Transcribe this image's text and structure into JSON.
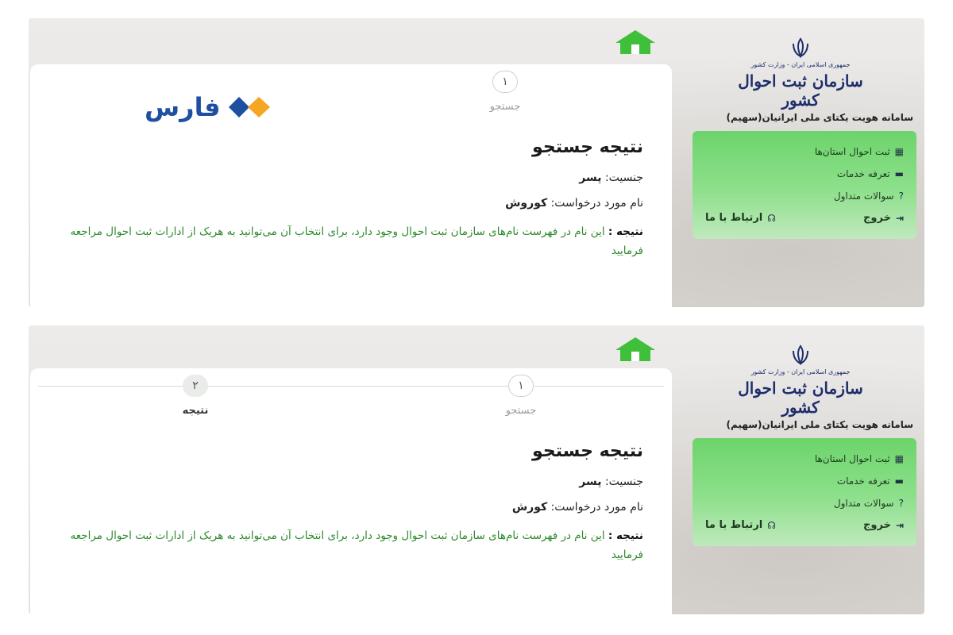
{
  "brand": {
    "watermark": "فارس"
  },
  "panels": [
    {
      "steps": [
        {
          "num": "۱",
          "label": "جستجو",
          "active": false
        }
      ],
      "result": {
        "title": "نتیجه جستجو",
        "gender_label": "جنسیت:",
        "gender_value": "پسر",
        "name_label": "نام مورد درخواست:",
        "name_value": "کوروش",
        "note_label": "نتیجه :",
        "note_text": "این نام در فهرست نام‌های سازمان ثبت احوال وجود دارد، برای انتخاب آن می‌توانید به هریک از ادارات ثبت احوال مراجعه فرمایید"
      }
    },
    {
      "steps": [
        {
          "num": "۱",
          "label": "جستجو",
          "active": false
        },
        {
          "num": "۲",
          "label": "نتیجه",
          "active": true
        }
      ],
      "result": {
        "title": "نتیجه جستجو",
        "gender_label": "جنسیت:",
        "gender_value": "پسر",
        "name_label": "نام مورد درخواست:",
        "name_value": "کورش",
        "note_label": "نتیجه :",
        "note_text": "این نام در فهرست نام‌های سازمان ثبت احوال وجود دارد، برای انتخاب آن می‌توانید به هریک از ادارات ثبت احوال مراجعه فرمایید"
      }
    }
  ],
  "sidebar": {
    "org_small": "جمهوری اسلامی ایران - وزارت کشور",
    "org_name": "سازمان ثبت احوال کشور",
    "system_title": "سامانه هویت یکتای ملی ایرانیان(سهیم)",
    "menu": [
      {
        "label": "ثبت احوال استان‌ها",
        "icon": "building-icon"
      },
      {
        "label": "تعرفه خدمات",
        "icon": "money-icon"
      },
      {
        "label": "سوالات متداول",
        "icon": "question-icon"
      }
    ],
    "exit_label": "خروج",
    "contact_label": "ارتباط با ما"
  },
  "colors": {
    "accent_green": "#3fbf3a",
    "note_green": "#2c8a2c",
    "brand_blue": "#1f4fa0",
    "brand_orange": "#f5a623"
  }
}
